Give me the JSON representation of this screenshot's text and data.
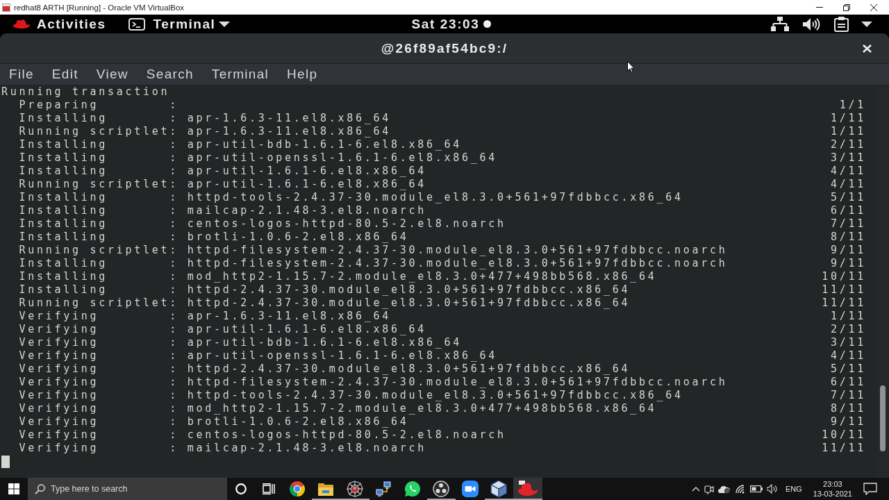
{
  "host_window": {
    "title": "redhat8 ARTH [Running] - Oracle VM VirtualBox"
  },
  "top_bar": {
    "activities": "Activities",
    "app_menu": "Terminal",
    "clock": "Sat 23:03",
    "notification_dot": true
  },
  "terminal": {
    "title": "@26f89af54bc9:/",
    "menu": [
      "File",
      "Edit",
      "View",
      "Search",
      "Terminal",
      "Help"
    ],
    "lines": [
      {
        "kind": "heading",
        "text": "Running transaction"
      },
      {
        "kind": "step",
        "text": "Preparing        :",
        "counter": "1/1"
      },
      {
        "kind": "step",
        "text": "Installing       : apr-1.6.3-11.el8.x86_64",
        "counter": "1/11"
      },
      {
        "kind": "step",
        "text": "Running scriptlet: apr-1.6.3-11.el8.x86_64",
        "counter": "1/11"
      },
      {
        "kind": "step",
        "text": "Installing       : apr-util-bdb-1.6.1-6.el8.x86_64",
        "counter": "2/11"
      },
      {
        "kind": "step",
        "text": "Installing       : apr-util-openssl-1.6.1-6.el8.x86_64",
        "counter": "3/11"
      },
      {
        "kind": "step",
        "text": "Installing       : apr-util-1.6.1-6.el8.x86_64",
        "counter": "4/11"
      },
      {
        "kind": "step",
        "text": "Running scriptlet: apr-util-1.6.1-6.el8.x86_64",
        "counter": "4/11"
      },
      {
        "kind": "step",
        "text": "Installing       : httpd-tools-2.4.37-30.module_el8.3.0+561+97fdbbcc.x86_64",
        "counter": "5/11"
      },
      {
        "kind": "step",
        "text": "Installing       : mailcap-2.1.48-3.el8.noarch",
        "counter": "6/11"
      },
      {
        "kind": "step",
        "text": "Installing       : centos-logos-httpd-80.5-2.el8.noarch",
        "counter": "7/11"
      },
      {
        "kind": "step",
        "text": "Installing       : brotli-1.0.6-2.el8.x86_64",
        "counter": "8/11"
      },
      {
        "kind": "step",
        "text": "Running scriptlet: httpd-filesystem-2.4.37-30.module_el8.3.0+561+97fdbbcc.noarch",
        "counter": "9/11"
      },
      {
        "kind": "step",
        "text": "Installing       : httpd-filesystem-2.4.37-30.module_el8.3.0+561+97fdbbcc.noarch",
        "counter": "9/11"
      },
      {
        "kind": "step",
        "text": "Installing       : mod_http2-1.15.7-2.module_el8.3.0+477+498bb568.x86_64",
        "counter": "10/11"
      },
      {
        "kind": "step",
        "text": "Installing       : httpd-2.4.37-30.module_el8.3.0+561+97fdbbcc.x86_64",
        "counter": "11/11"
      },
      {
        "kind": "step",
        "text": "Running scriptlet: httpd-2.4.37-30.module_el8.3.0+561+97fdbbcc.x86_64",
        "counter": "11/11"
      },
      {
        "kind": "step",
        "text": "Verifying        : apr-1.6.3-11.el8.x86_64",
        "counter": "1/11"
      },
      {
        "kind": "step",
        "text": "Verifying        : apr-util-1.6.1-6.el8.x86_64",
        "counter": "2/11"
      },
      {
        "kind": "step",
        "text": "Verifying        : apr-util-bdb-1.6.1-6.el8.x86_64",
        "counter": "3/11"
      },
      {
        "kind": "step",
        "text": "Verifying        : apr-util-openssl-1.6.1-6.el8.x86_64",
        "counter": "4/11"
      },
      {
        "kind": "step",
        "text": "Verifying        : httpd-2.4.37-30.module_el8.3.0+561+97fdbbcc.x86_64",
        "counter": "5/11"
      },
      {
        "kind": "step",
        "text": "Verifying        : httpd-filesystem-2.4.37-30.module_el8.3.0+561+97fdbbcc.noarch",
        "counter": "6/11"
      },
      {
        "kind": "step",
        "text": "Verifying        : httpd-tools-2.4.37-30.module_el8.3.0+561+97fdbbcc.x86_64",
        "counter": "7/11"
      },
      {
        "kind": "step",
        "text": "Verifying        : mod_http2-1.15.7-2.module_el8.3.0+477+498bb568.x86_64",
        "counter": "8/11"
      },
      {
        "kind": "step",
        "text": "Verifying        : brotli-1.0.6-2.el8.x86_64",
        "counter": "9/11"
      },
      {
        "kind": "step",
        "text": "Verifying        : centos-logos-httpd-80.5-2.el8.noarch",
        "counter": "10/11"
      },
      {
        "kind": "step",
        "text": "Verifying        : mailcap-2.1.48-3.el8.noarch",
        "counter": "11/11"
      }
    ]
  },
  "taskbar": {
    "search": {
      "placeholder": "Type here to search"
    },
    "apps": [
      {
        "running": false,
        "selected": false
      },
      {
        "running": true,
        "selected": false
      },
      {
        "running": true,
        "selected": false
      },
      {
        "running": false,
        "selected": false
      },
      {
        "running": false,
        "selected": false
      },
      {
        "running": true,
        "selected": false
      },
      {
        "running": false,
        "selected": false
      },
      {
        "running": true,
        "selected": false
      },
      {
        "running": true,
        "selected": true
      }
    ],
    "language": "ENG",
    "time": "23:03",
    "date": "13-03-2021"
  }
}
